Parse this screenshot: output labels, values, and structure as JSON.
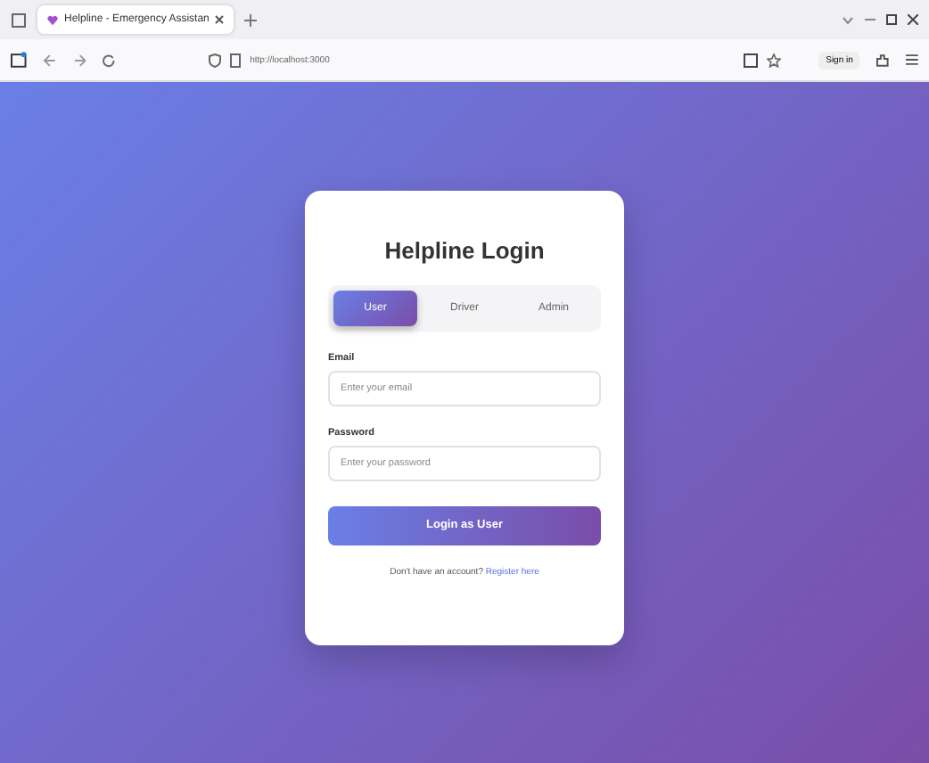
{
  "browser": {
    "tab_title": "Helpline - Emergency Assistan",
    "url": "http://localhost:3000",
    "sign_in": "Sign in"
  },
  "login": {
    "title": "Helpline Login",
    "roles": [
      {
        "label": "User",
        "selected": true
      },
      {
        "label": "Driver",
        "selected": false
      },
      {
        "label": "Admin",
        "selected": false
      }
    ],
    "fields": [
      {
        "label": "Email",
        "placeholder": "Enter your email"
      },
      {
        "label": "Password",
        "placeholder": "Enter your password"
      }
    ],
    "submit": "Login as User",
    "footer": {
      "text": "Don't have an account?",
      "link": "Register here"
    }
  }
}
